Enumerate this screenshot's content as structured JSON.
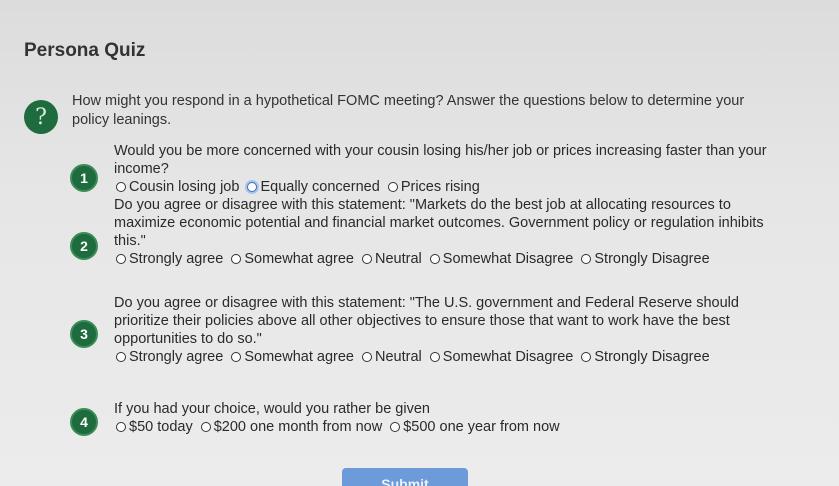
{
  "title": "Persona Quiz",
  "intro": "How might you respond in a hypothetical FOMC meeting? Answer the questions below to determine your policy leanings.",
  "intro_icon": "?",
  "questions": [
    {
      "number": "1",
      "text": "Would you be more concerned with your cousin losing his/her job or prices increasing faster than your income?",
      "options": [
        "Cousin losing job",
        "Equally concerned",
        "Prices rising"
      ],
      "selected": "Equally concerned"
    },
    {
      "number": "2",
      "text": "Do you agree or disagree with this statement: \"Markets do the best job at allocating resources to maximize economic potential and financial market outcomes. Government policy or regulation inhibits this.\"",
      "options": [
        "Strongly agree",
        "Somewhat agree",
        "Neutral",
        "Somewhat Disagree",
        "Strongly Disagree"
      ]
    },
    {
      "number": "3",
      "text": "Do you agree or disagree with this statement: \"The U.S. government and Federal Reserve should prioritize their policies above all other objectives to ensure those that want to work have the best opportunities to do so.\"",
      "options": [
        "Strongly agree",
        "Somewhat agree",
        "Neutral",
        "Somewhat Disagree",
        "Strongly Disagree"
      ]
    },
    {
      "number": "4",
      "text": "If you had your choice, would you rather be given",
      "options": [
        "$50 today",
        "$200 one month from now",
        "$500 one year from now"
      ]
    }
  ],
  "submit_label": "Submit"
}
